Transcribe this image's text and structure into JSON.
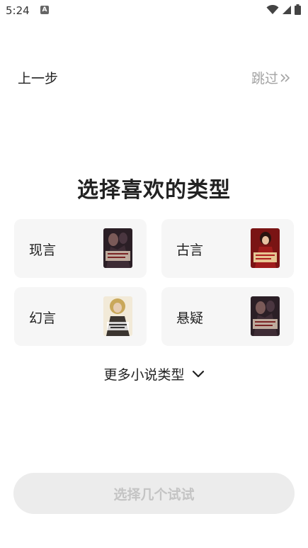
{
  "status_bar": {
    "time": "5:24",
    "app_icon_letter": "A",
    "icons": [
      "wifi-icon",
      "signal-icon",
      "battery-icon"
    ]
  },
  "nav": {
    "back_label": "上一步",
    "skip_label": "跳过",
    "skip_icon": "double-chevron-right-icon"
  },
  "title": "选择喜欢的类型",
  "genres": [
    {
      "label": "现言",
      "cover": "book-cover-xianyan"
    },
    {
      "label": "古言",
      "cover": "book-cover-guyan"
    },
    {
      "label": "幻言",
      "cover": "book-cover-huanyan"
    },
    {
      "label": "悬疑",
      "cover": "book-cover-xuanyi"
    }
  ],
  "more": {
    "label": "更多小说类型",
    "icon": "chevron-down-icon"
  },
  "submit": {
    "label": "选择几个试试"
  },
  "colors": {
    "card_bg": "#f6f6f6",
    "button_bg": "#ececec",
    "button_text": "#c4c4c4",
    "skip_text": "#a3a3a3"
  }
}
